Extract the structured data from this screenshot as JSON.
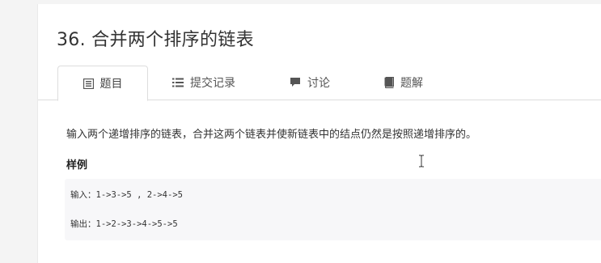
{
  "problem": {
    "title": "36. 合并两个排序的链表"
  },
  "tabs": [
    {
      "label": "题目",
      "icon": "document-icon",
      "active": true
    },
    {
      "label": "提交记录",
      "icon": "list-icon",
      "active": false
    },
    {
      "label": "讨论",
      "icon": "chat-icon",
      "active": false
    },
    {
      "label": "题解",
      "icon": "book-icon",
      "active": false
    }
  ],
  "content": {
    "description": "输入两个递增排序的链表，合并这两个链表并使新链表中的结点仍然是按照递增排序的。",
    "example_heading": "样例",
    "example_input": "输入：1->3->5 , 2->4->5",
    "example_output": "输出：1->2->3->4->5->5"
  },
  "colors": {
    "background": "#f4f4f4",
    "card": "#ffffff",
    "code_bg": "#f7f7f9",
    "text": "#333333"
  }
}
